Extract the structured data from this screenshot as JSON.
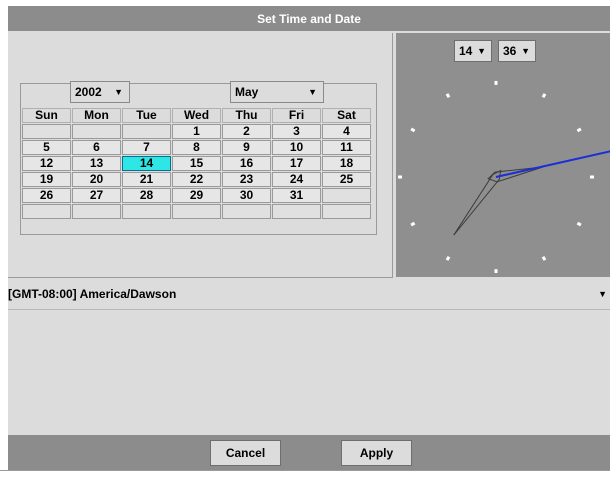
{
  "dialog": {
    "title": "Set Time and Date"
  },
  "calendar": {
    "year": "2002",
    "month": "May",
    "weekdays": [
      "Sun",
      "Mon",
      "Tue",
      "Wed",
      "Thu",
      "Fri",
      "Sat"
    ],
    "weeks": [
      [
        "",
        "",
        "",
        "1",
        "2",
        "3",
        "4"
      ],
      [
        "5",
        "6",
        "7",
        "8",
        "9",
        "10",
        "11"
      ],
      [
        "12",
        "13",
        "14",
        "15",
        "16",
        "17",
        "18"
      ],
      [
        "19",
        "20",
        "21",
        "22",
        "23",
        "24",
        "25"
      ],
      [
        "26",
        "27",
        "28",
        "29",
        "30",
        "31",
        ""
      ],
      [
        "",
        "",
        "",
        "",
        "",
        "",
        ""
      ]
    ],
    "selected_day": "14"
  },
  "clock": {
    "hour": "14",
    "minute": "36"
  },
  "timezone": {
    "label": "[GMT-08:00]  America/Dawson"
  },
  "buttons": {
    "cancel": "Cancel",
    "apply": "Apply"
  },
  "icons": {
    "dropdown": "chevron-down-icon"
  },
  "colors": {
    "title_bar": "#8c8c8c",
    "selected_day": "#2ee6e6",
    "clock_face": "#8f8f8f",
    "second_hand": "#1a2fd6"
  }
}
